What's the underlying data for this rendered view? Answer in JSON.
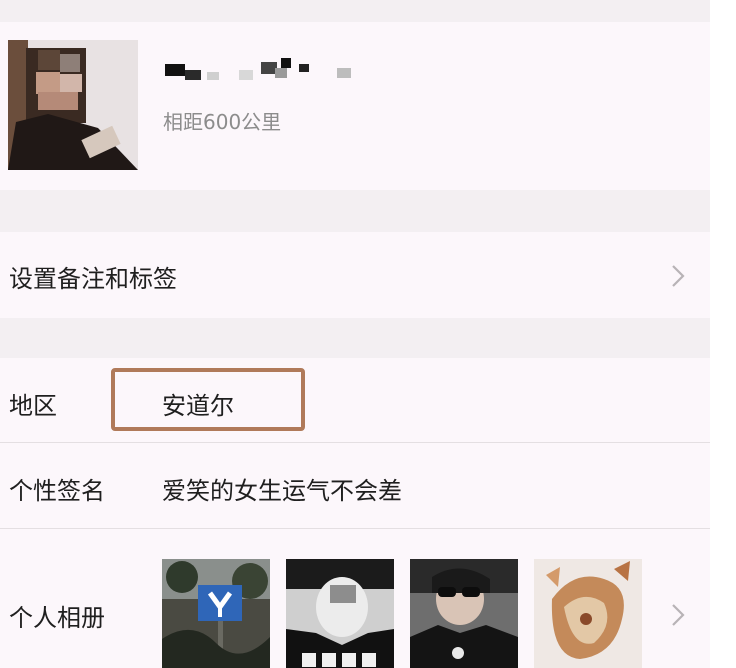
{
  "profile": {
    "avatar_icon": "profile-avatar-photo",
    "nickname": "",
    "distance": "相距600公里"
  },
  "remark_row": {
    "label": "设置备注和标签",
    "chevron_icon": "chevron-right-icon"
  },
  "info": {
    "region_label": "地区",
    "region_value": "安道尔",
    "signature_label": "个性签名",
    "signature_value": "爱笑的女生运气不会差",
    "album_label": "个人相册",
    "album_chevron_icon": "chevron-right-icon",
    "album_photos": [
      "photo-road-sign",
      "photo-woman-mask",
      "photo-woman-sunglasses",
      "photo-drawing"
    ]
  },
  "colors": {
    "page_bg": "#f3eff2",
    "card_bg": "#fcf7fb",
    "highlight_border": "#b07a5a",
    "secondary_text": "#8c8c8c"
  }
}
